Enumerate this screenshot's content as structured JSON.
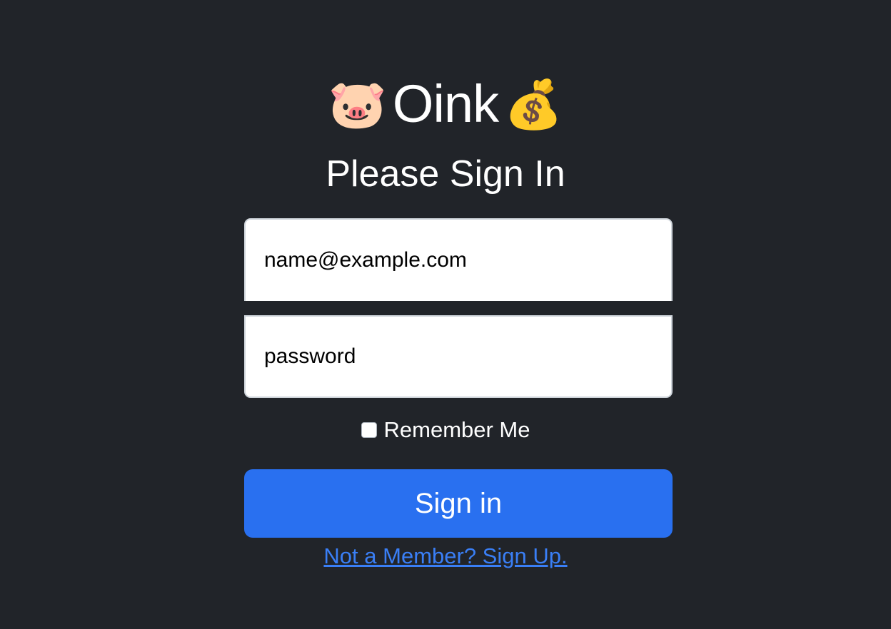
{
  "brand": {
    "left_emoji": "🐷",
    "name": "Oink",
    "right_emoji": "💰",
    "left_icon": "pig-face-icon",
    "right_icon": "money-bag-icon"
  },
  "heading": "Please Sign In",
  "form": {
    "email": {
      "value": "",
      "placeholder": "name@example.com"
    },
    "password": {
      "value": "",
      "placeholder": "password"
    },
    "remember_label": "Remember Me",
    "remember_checked": false,
    "submit_label": "Sign in",
    "signup_link": "Not a Member? Sign Up."
  },
  "colors": {
    "background": "#212429",
    "primary": "#2970f0",
    "link": "#3a7ff6"
  }
}
